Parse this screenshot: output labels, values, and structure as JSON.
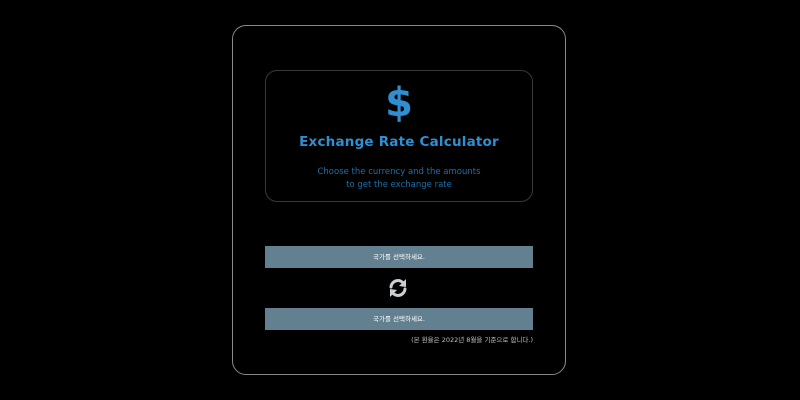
{
  "colors": {
    "background": "#000000",
    "accent": "#2f8fd0",
    "subtitle": "#1f6fa8",
    "select_bg": "#62808f",
    "select_text": "#ffffff",
    "icon": "#c8d0d4",
    "footnote": "#c0c0c0"
  },
  "header": {
    "icon": "dollar-icon",
    "icon_glyph": "$",
    "title": "Exchange Rate Calculator",
    "subtitle_line1": "Choose the currency and the amounts",
    "subtitle_line2": "to get the exchange rate"
  },
  "form": {
    "from_select_label": "국가를 선택하세요.",
    "swap_icon": "swap-icon",
    "to_select_label": "국가를 선택하세요.",
    "footnote": "(본 환율은 2022년 8월을 기준으로 합니다.)"
  }
}
